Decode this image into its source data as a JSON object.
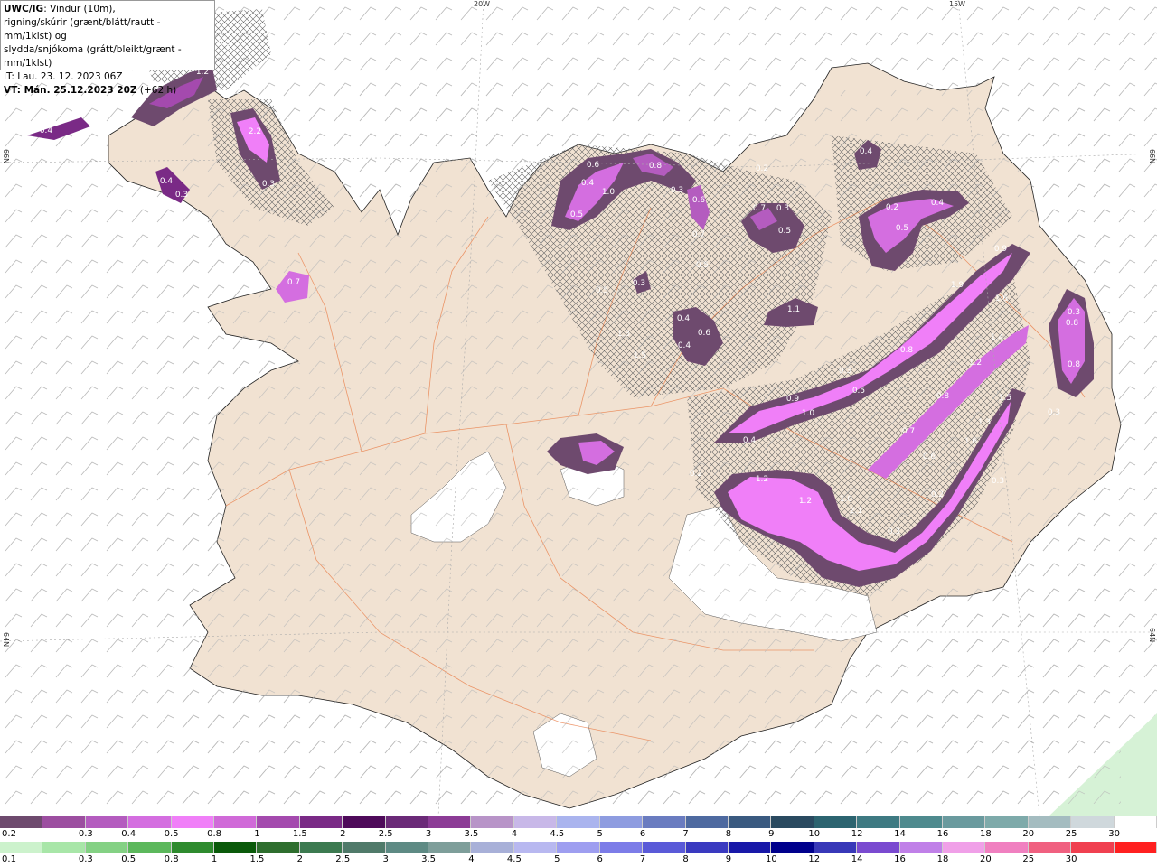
{
  "info": {
    "model": "UWC/IG",
    "line1_rest": ": Vindur (10m),",
    "line2": "rigning/skúrir (grænt/blátt/rautt - mm/1klst) og",
    "line3": "slydda/snjókoma (grátt/bleikt/grænt - mm/1klst)",
    "it": "IT: Lau. 23. 12. 2023 06Z",
    "vt_bold": "VT: Mán. 25.12.2023 20Z",
    "vt_rest": " (+62 h)"
  },
  "grid_labels": {
    "lon_20w": "20W",
    "lon_15w": "15W",
    "lat_66n_left": "66N",
    "lat_66n_right": "66N",
    "lat_64n_left": "64N",
    "lat_64n_right": "64N"
  },
  "precip_labels": [
    "0.5",
    "1.2",
    "0.4",
    "0.5",
    "2.2",
    "0.3",
    "0.4",
    "0.3",
    "0.7",
    "0.6",
    "0.4",
    "1.0",
    "0.5",
    "0.8",
    "0.6",
    "0.7",
    "0.5",
    "0.3",
    "0.7",
    "0.3",
    "0.5",
    "0.2",
    "0.4",
    "0.4",
    "0.5",
    "0.2",
    "0.3",
    "0.5",
    "0.9",
    "1.9",
    "1.6",
    "0.3",
    "0.8",
    "0.8",
    "0.8",
    "0.3",
    "1.4",
    "1.2",
    "0.5",
    "0.9",
    "1.0",
    "0.4",
    "0.8",
    "0.7",
    "1.5",
    "1.3",
    "1.6",
    "0.4",
    "0.6",
    "0.4",
    "1.1",
    "1.5",
    "1.3",
    "1.2",
    "1.2",
    "1.0",
    "2.1",
    "0.3",
    "0.2",
    "0.6",
    "0.3",
    "0.3",
    "0.2"
  ],
  "legend": {
    "snow_colors": [
      "#6e4a6e",
      "#9c4ea0",
      "#b45cbf",
      "#d46ee0",
      "#f07ff8",
      "#d06ad8",
      "#a44aae",
      "#7a2a86",
      "#4e0a5a",
      "#6b2a78",
      "#8c3c96",
      "#b894c8",
      "#c8b8e8",
      "#aab4ee",
      "#8e9ce0",
      "#6a7cc0",
      "#4e6aa0",
      "#3a5a80",
      "#2a4a60",
      "#2c6470",
      "#3e7a82",
      "#4e8a8e",
      "#6a9a9e",
      "#7eaaaa",
      "#a4bcc0",
      "#cfd8dc",
      "#ffffff"
    ],
    "snow_ticks": [
      "0.2",
      "0.3",
      "0.4",
      "0.5",
      "0.8",
      "1",
      "1.5",
      "2",
      "2.5",
      "3",
      "3.5",
      "4",
      "4.5",
      "5",
      "6",
      "7",
      "8",
      "9",
      "10",
      "12",
      "14",
      "16",
      "18",
      "20",
      "25",
      "30"
    ],
    "rain_colors": [
      "#ccf2cc",
      "#a8e6a8",
      "#84d184",
      "#5cb85c",
      "#2e8b2e",
      "#0a5a0a",
      "#2e6e2e",
      "#3c7a50",
      "#507a6a",
      "#5e8a84",
      "#7e9e9a",
      "#a8b0d8",
      "#b8b8f0",
      "#9e9ef0",
      "#7c7ce8",
      "#5a5ad8",
      "#3a3ac0",
      "#1818a8",
      "#00008c",
      "#3838b8",
      "#7a4ad0",
      "#c080e8",
      "#f0a0e8",
      "#f080c0",
      "#f06080",
      "#f04050",
      "#ff2020"
    ],
    "rain_ticks": [
      "0.1",
      "0.3",
      "0.5",
      "0.8",
      "1",
      "1.5",
      "2",
      "2.5",
      "3",
      "3.5",
      "4",
      "4.5",
      "5",
      "6",
      "7",
      "8",
      "9",
      "10",
      "12",
      "14",
      "16",
      "18",
      "20",
      "25",
      "30"
    ]
  }
}
